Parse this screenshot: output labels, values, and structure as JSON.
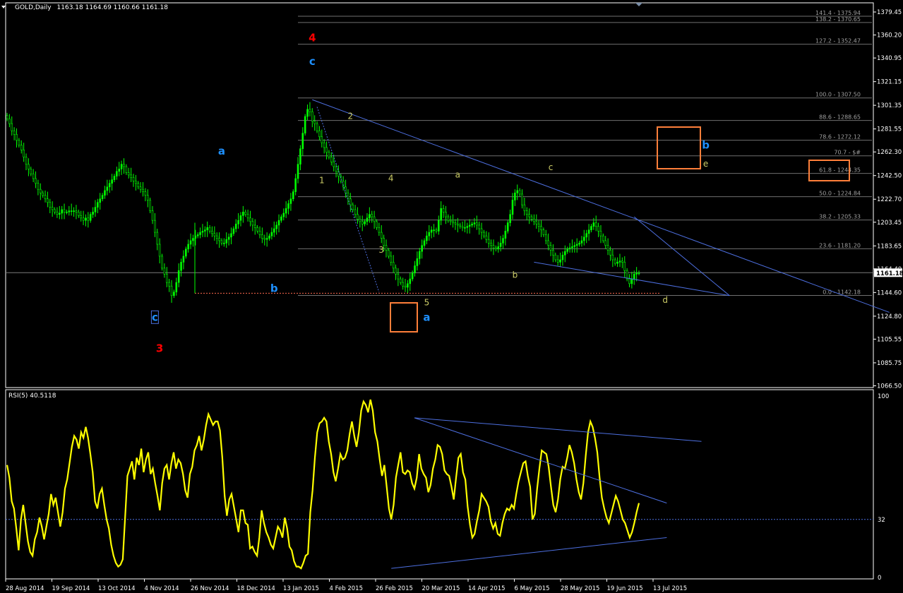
{
  "header": {
    "title": "GOLD,Daily",
    "ohlc": "1163.18 1164.69 1160.66 1161.18",
    "rsi_title": "RSI(5) 40.5118"
  },
  "chart_data": [
    {
      "type": "candlestick",
      "title": "GOLD,Daily",
      "ohlc_readout": {
        "open": 1163.18,
        "high": 1164.69,
        "low": 1160.66,
        "close": 1161.18
      },
      "current_price": 1161.18,
      "ylim": [
        1060,
        1392
      ],
      "price_ticks": [
        "1379.45",
        "1360.20",
        "1340.95",
        "1321.15",
        "1301.35",
        "1281.55",
        "1262.30",
        "1242.50",
        "1222.70",
        "1203.45",
        "1183.65",
        "1164.40",
        "1144.60",
        "1124.80",
        "1105.55",
        "1085.75",
        "1066.50"
      ],
      "date_ticks": [
        "28 Aug 2014",
        "19 Sep 2014",
        "13 Oct 2014",
        "4 Nov 2014",
        "26 Nov 2014",
        "18 Dec 2014",
        "13 Jan 2015",
        "4 Feb 2015",
        "26 Feb 2015",
        "20 Mar 2015",
        "14 Apr 2015",
        "6 May 2015",
        "28 May 2015",
        "19 Jun 2015",
        "13 Jul 2015"
      ],
      "closes": [
        1290,
        1286,
        1280,
        1277,
        1272,
        1268,
        1264,
        1258,
        1252,
        1248,
        1244,
        1240,
        1236,
        1231,
        1228,
        1226,
        1223,
        1220,
        1216,
        1214,
        1212,
        1210,
        1211,
        1214,
        1212,
        1212,
        1213,
        1213,
        1213,
        1212,
        1209,
        1207,
        1205,
        1207,
        1205,
        1210,
        1212,
        1216,
        1220,
        1223,
        1226,
        1230,
        1233,
        1236,
        1239,
        1242,
        1246,
        1248,
        1252,
        1250,
        1245,
        1243,
        1241,
        1238,
        1236,
        1233,
        1231,
        1229,
        1226,
        1222,
        1213,
        1205,
        1195,
        1185,
        1175,
        1165,
        1160,
        1153,
        1150,
        1142,
        1145,
        1153,
        1163,
        1170,
        1175,
        1181,
        1185,
        1188,
        1190,
        1192,
        1193,
        1195,
        1196,
        1197,
        1199,
        1196,
        1194,
        1192,
        1190,
        1188,
        1186,
        1186,
        1189,
        1191,
        1194,
        1198,
        1202,
        1205,
        1209,
        1212,
        1210,
        1207,
        1204,
        1201,
        1199,
        1196,
        1193,
        1190,
        1189,
        1190,
        1192,
        1195,
        1198,
        1201,
        1205,
        1208,
        1211,
        1215,
        1219,
        1223,
        1229,
        1240,
        1252,
        1265,
        1278,
        1292,
        1298,
        1296,
        1288,
        1286,
        1280,
        1275,
        1270,
        1266,
        1262,
        1258,
        1254,
        1250,
        1246,
        1242,
        1238,
        1233,
        1228,
        1223,
        1218,
        1214,
        1210,
        1206,
        1204,
        1202,
        1204,
        1207,
        1210,
        1208,
        1204,
        1199,
        1195,
        1190,
        1184,
        1180,
        1175,
        1170,
        1165,
        1160,
        1156,
        1153,
        1150,
        1149,
        1152,
        1156,
        1161,
        1167,
        1173,
        1179,
        1184,
        1188,
        1192,
        1195,
        1197,
        1197,
        1196,
        1205,
        1215,
        1212,
        1208,
        1205,
        1204,
        1203,
        1202,
        1201,
        1200,
        1199,
        1199,
        1200,
        1201,
        1202,
        1203,
        1201,
        1198,
        1195,
        1192,
        1189,
        1186,
        1184,
        1182,
        1181,
        1183,
        1186,
        1190,
        1196,
        1203,
        1210,
        1222,
        1228,
        1230,
        1227,
        1218,
        1213,
        1210,
        1208,
        1206,
        1204,
        1202,
        1200,
        1197,
        1193,
        1188,
        1184,
        1180,
        1176,
        1172,
        1170,
        1172,
        1176,
        1179,
        1181,
        1182,
        1183,
        1184,
        1185,
        1186,
        1188,
        1191,
        1194,
        1197,
        1200,
        1203,
        1200,
        1196,
        1192,
        1188,
        1184,
        1180,
        1176,
        1172,
        1169,
        1170,
        1171,
        1170,
        1163,
        1156,
        1152,
        1156,
        1160,
        1161,
        1161
      ],
      "levels": [
        {
          "label": "141.4 - 1375.94",
          "price": 1375.94
        },
        {
          "label": "138.2 - 1370.65",
          "price": 1370.65
        },
        {
          "label": "127.2 - 1352.47",
          "price": 1352.47
        },
        {
          "label": "100.0 - 1307.50",
          "price": 1307.5
        },
        {
          "label": "88.6 - 1288.65",
          "price": 1288.65
        },
        {
          "label": "78.6 - 1272.12",
          "price": 1272.12
        },
        {
          "label": "70.7 - $#",
          "price": 1259.05
        },
        {
          "label": "61.8 - 1244.35",
          "price": 1244.35
        },
        {
          "label": "50.0 - 1224.84",
          "price": 1224.84
        },
        {
          "label": "38.2 - 1205.33",
          "price": 1205.33
        },
        {
          "label": "23.6 - 1181.20",
          "price": 1181.2
        },
        {
          "label": "0.0 - 1142.18",
          "price": 1142.18
        }
      ],
      "annotations": [
        {
          "text": "4",
          "color": "#ff0000",
          "big": true,
          "date_index": 128,
          "price": 1355
        },
        {
          "text": "3",
          "color": "#ff0000",
          "big": true,
          "date_index": 64,
          "price": 1095
        },
        {
          "text": "c",
          "color": "#1e90ff",
          "big": true,
          "date_index": 128,
          "price": 1335
        },
        {
          "text": "a",
          "color": "#1e90ff",
          "big": true,
          "date_index": 90,
          "price": 1260
        },
        {
          "text": "b",
          "color": "#1e90ff",
          "big": true,
          "date_index": 112,
          "price": 1145
        },
        {
          "text": "c",
          "color": "#1e90ff",
          "big": true,
          "boxed": true,
          "date_index": 62,
          "price": 1121
        },
        {
          "text": "a",
          "color": "#1e90ff",
          "big": true,
          "date_index": 176,
          "price": 1121
        },
        {
          "text": "b",
          "color": "#1e90ff",
          "big": true,
          "date_index": 293,
          "price": 1265
        },
        {
          "text": "1",
          "color": "#cccc66",
          "big": false,
          "date_index": 132,
          "price": 1236
        },
        {
          "text": "2",
          "color": "#cccc66",
          "big": false,
          "date_index": 144,
          "price": 1290
        },
        {
          "text": "3",
          "color": "#cccc66",
          "big": false,
          "date_index": 157,
          "price": 1178
        },
        {
          "text": "4",
          "color": "#cccc66",
          "big": false,
          "date_index": 161,
          "price": 1238
        },
        {
          "text": "5",
          "color": "#cccc66",
          "big": false,
          "date_index": 176,
          "price": 1134
        },
        {
          "text": "a",
          "color": "#cccc66",
          "big": false,
          "date_index": 189,
          "price": 1241
        },
        {
          "text": "b",
          "color": "#cccc66",
          "big": false,
          "date_index": 213,
          "price": 1157
        },
        {
          "text": "c",
          "color": "#cccc66",
          "big": false,
          "date_index": 228,
          "price": 1247
        },
        {
          "text": "d",
          "color": "#cccc66",
          "big": false,
          "date_index": 276,
          "price": 1136
        },
        {
          "text": "e",
          "color": "#cccc66",
          "big": false,
          "date_index": 293,
          "price": 1250
        }
      ]
    },
    {
      "type": "line",
      "title": "RSI(5) 40.5118",
      "ylim": [
        0,
        100
      ],
      "ticks": [
        "100",
        "32",
        "0"
      ],
      "level": 32,
      "values": [
        62,
        55,
        42,
        38,
        27,
        15,
        32,
        40,
        30,
        20,
        14,
        12,
        21,
        25,
        33,
        28,
        21,
        28,
        35,
        46,
        40,
        44,
        36,
        28,
        36,
        49,
        54,
        63,
        72,
        78,
        76,
        71,
        80,
        77,
        83,
        77,
        68,
        58,
        42,
        38,
        46,
        49,
        40,
        32,
        27,
        18,
        12,
        8,
        6,
        7,
        10,
        33,
        56,
        60,
        64,
        54,
        66,
        62,
        71,
        58,
        65,
        69,
        57,
        60,
        52,
        45,
        37,
        52,
        60,
        62,
        54,
        63,
        69,
        60,
        65,
        63,
        57,
        48,
        44,
        57,
        61,
        70,
        73,
        78,
        70,
        76,
        84,
        90,
        87,
        84,
        86,
        86,
        81,
        66,
        45,
        34,
        43,
        46,
        39,
        32,
        25,
        37,
        37,
        30,
        29,
        16,
        17,
        14,
        12,
        22,
        37,
        30,
        25,
        22,
        18,
        16,
        22,
        28,
        26,
        22,
        33,
        27,
        17,
        15,
        9,
        6,
        6,
        5,
        8,
        12,
        13,
        36,
        48,
        66,
        80,
        85,
        86,
        88,
        86,
        75,
        68,
        58,
        53,
        60,
        68,
        65,
        66,
        70,
        79,
        86,
        78,
        72,
        80,
        92,
        97,
        95,
        91,
        98,
        92,
        80,
        75,
        65,
        56,
        62,
        50,
        38,
        32,
        40,
        55,
        62,
        69,
        58,
        57,
        59,
        58,
        52,
        49,
        55,
        68,
        60,
        57,
        55,
        47,
        51,
        60,
        65,
        73,
        72,
        68,
        59,
        57,
        56,
        50,
        43,
        55,
        66,
        68,
        58,
        54,
        39,
        29,
        22,
        24,
        31,
        37,
        46,
        44,
        42,
        39,
        31,
        27,
        30,
        24,
        23,
        30,
        35,
        38,
        37,
        40,
        38,
        46,
        53,
        58,
        63,
        64,
        56,
        50,
        32,
        35,
        49,
        60,
        70,
        69,
        68,
        61,
        50,
        40,
        36,
        43,
        54,
        61,
        60,
        66,
        73,
        69,
        63,
        54,
        47,
        43,
        52,
        67,
        80,
        86,
        83,
        77,
        69,
        55,
        44,
        38,
        33,
        30,
        35,
        40,
        45,
        42,
        37,
        32,
        30,
        26,
        22,
        25,
        30,
        36,
        41
      ]
    }
  ]
}
